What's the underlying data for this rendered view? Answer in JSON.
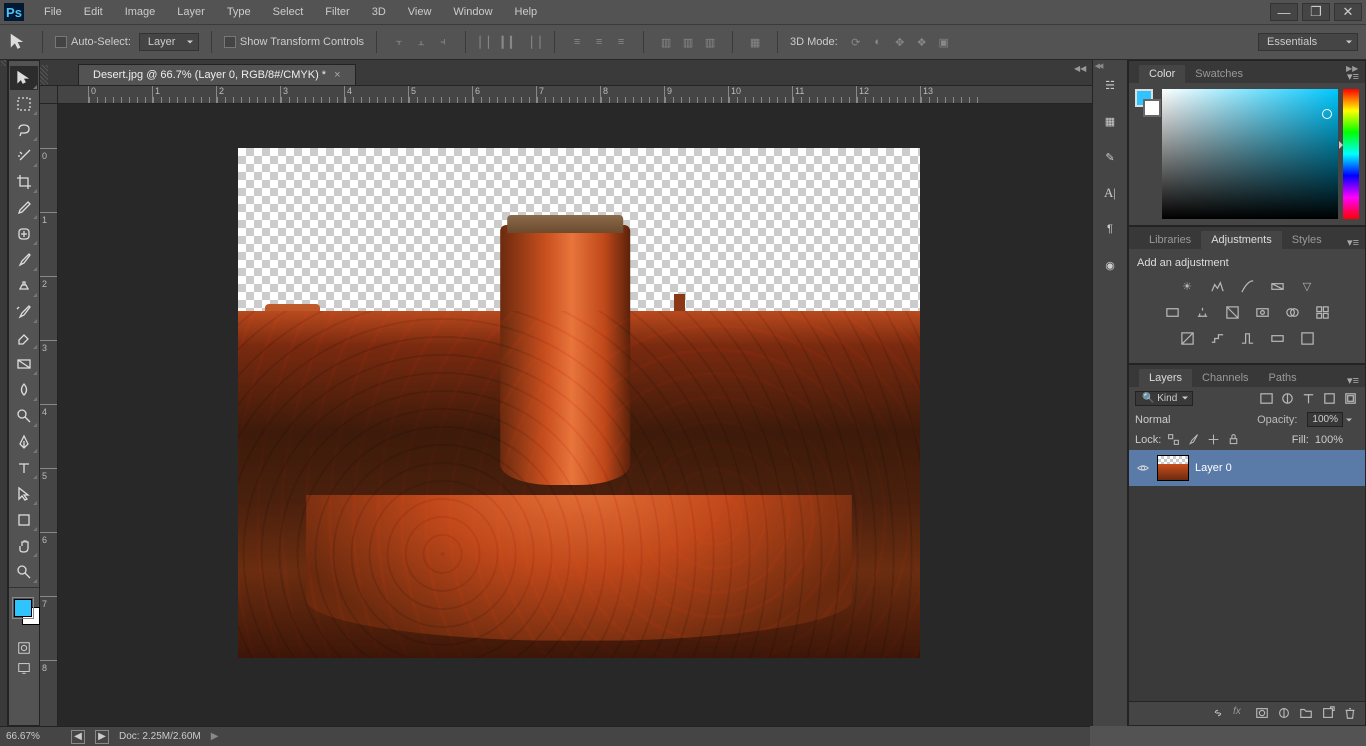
{
  "titlebar": {
    "logo": "Ps",
    "menu": [
      "File",
      "Edit",
      "Image",
      "Layer",
      "Type",
      "Select",
      "Filter",
      "3D",
      "View",
      "Window",
      "Help"
    ]
  },
  "options": {
    "auto_select_label": "Auto-Select:",
    "auto_select_target": "Layer",
    "show_transform_label": "Show Transform Controls",
    "mode3d_label": "3D Mode:",
    "workspace": "Essentials"
  },
  "document": {
    "tab_title": "Desert.jpg @ 66.7% (Layer 0, RGB/8#/CMYK) *"
  },
  "ruler": {
    "h": [
      "0",
      "1",
      "2",
      "3",
      "4",
      "5",
      "6",
      "7",
      "8",
      "9",
      "10",
      "11",
      "12",
      "13"
    ],
    "v": [
      "0",
      "1",
      "2",
      "3",
      "4",
      "5",
      "6",
      "7",
      "8"
    ]
  },
  "panels": {
    "color": {
      "tabs": [
        "Color",
        "Swatches"
      ]
    },
    "adjustments": {
      "tabs": [
        "Libraries",
        "Adjustments",
        "Styles"
      ],
      "heading": "Add an adjustment"
    },
    "layers": {
      "tabs": [
        "Layers",
        "Channels",
        "Paths"
      ],
      "filter_label": "Kind",
      "blend_mode": "Normal",
      "opacity_label": "Opacity:",
      "opacity_val": "100%",
      "lock_label": "Lock:",
      "fill_label": "Fill:",
      "fill_val": "100%",
      "items": [
        {
          "name": "Layer 0"
        }
      ]
    }
  },
  "status": {
    "zoom": "66.67%",
    "doc_info": "Doc: 2.25M/2.60M"
  }
}
